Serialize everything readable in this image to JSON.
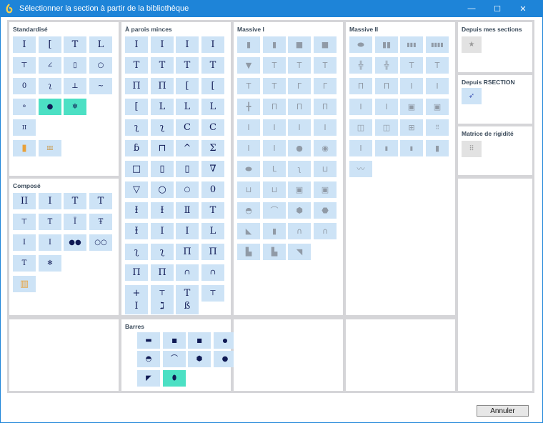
{
  "window": {
    "title": "Sélectionner la section à partir de la bibliothèque",
    "min_glyph": "—",
    "max_glyph": "☐",
    "close_glyph": "✕"
  },
  "panels": {
    "standardise": "Standardisé",
    "compose": "Composé",
    "parois": "À parois minces",
    "barres": "Barres",
    "massive1": "Massive I",
    "massive2": "Massive II",
    "depuis_sections": "Depuis mes sections",
    "rsection": "Depuis RSECTION",
    "rigidite": "Matrice de rigidité"
  },
  "cancel_label": "Annuler",
  "accent_color": "#1e84d8",
  "tile_color": "#cde3f6",
  "selected_color": "#4ce0c4",
  "icons": {
    "star": "★",
    "rsection": "➶",
    "matrix": "⠿"
  }
}
